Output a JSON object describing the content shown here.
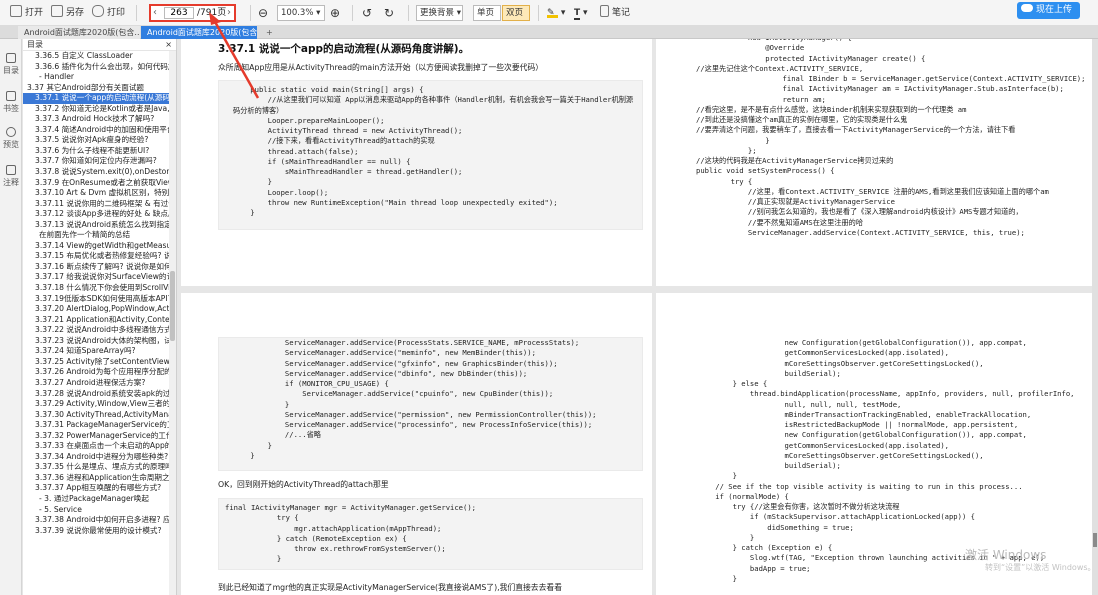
{
  "toolbar": {
    "open": "打开",
    "saveas": "另存",
    "print": "打印",
    "page_current": "263",
    "page_total": "/791页",
    "zoom": "100.3%",
    "background": "更换背景",
    "single": "单页",
    "double": "双页",
    "note": "笔记",
    "upload": "现在上传"
  },
  "tabs": [
    {
      "label": "Android面试题库2020版(包含..."
    },
    {
      "label": "Android面试题库2020版(包含..."
    }
  ],
  "left_strip": [
    "目录",
    "书签",
    "预览",
    "注释"
  ],
  "toc": {
    "title": "目录",
    "items": [
      "3.36.5 自定义 ClassLoader",
      "3.36.6 插件化为什么会出现，如何代码加",
      "- Handler",
      "3.37 其它Android部分有关面试题",
      "3.37.1 说说一个app的启动流程(从源码角度讲解)",
      "3.37.2 你知道无论是Kotlin或者是Java,我们",
      "3.37.3 Android Hock技术了解吗?",
      "3.37.4 简述Android中的加固和使用平台",
      "3.37.5 说说你对Apk瘦身的经验?",
      "3.37.6 为什么子线程不能更新UI?",
      "3.37.7 你知道如何定位内存泄漏吗?",
      "3.37.8 说说System.exit(0),onDestory(),A",
      "3.37.9 在OnResume或者之前获取View的",
      "3.37.10 Art & Dvm 虚拟机区别，特别是",
      "3.37.11 说说你用的二维码框架 & 有过优",
      "3.37.12 谈谈App多进程的好处 & 缺点。",
      "3.37.13 说说Android系统怎么找到指定的",
      "在前面先作一个精简的总结",
      "3.37.14 View的getWidth和getMeasure",
      "3.37.15 布局优化或者热修复经验吗? 说说",
      "3.37.16 断点续传了解吗? 说说你是如何实",
      "3.37.17 给我说说你对SurfaceView的认识",
      "3.37.18 什么情况下你会使用到ScrollView",
      "3.37.19低版本SDK如何使用高版本API?",
      "3.37.20 AlertDialog,PopWindow,Activit",
      "3.37.21 Application和Activity,Context的",
      "3.37.22 说说Android中多线程通信方式?",
      "3.37.23 说说Android大体的架构图，试着",
      "3.37.24 知道SpareArray吗?",
      "3.37.25 Activity除了setContentView可以",
      "3.37.26 Android为每个应用程序分配的内",
      "3.37.27 Android进程保活方案?",
      "3.37.28 说说Android系统安装apk的过程",
      "3.37.29 Activity,Window,View三者的关系",
      "3.37.30 ActivityThread,ActivityManager",
      "3.37.31 PackageManagerService的工作",
      "3.37.32 PowerManagerService的工作方",
      "3.37.33 在桌面点击一个未启动的App的流",
      "3.37.34 Android中进程分为哪些种类?",
      "3.37.35 什么是埋点、埋点方式的原理吗?",
      "3.37.36 进程和Application生命周期之间",
      "3.37.37 App相互唤醒的有哪些方式?",
      "- 3. 通过PackageManager唤起",
      "- 5. Service",
      "3.37.38 Android中如何开启多进程? 应用",
      "3.37.39 说说你最常使用的设计模式?"
    ]
  },
  "page1": {
    "title": "3.37.1 说说一个app的启动流程(从源码角度讲解)。",
    "intro": "众所周知App应用是从ActivityThread的main方法开始（以方便阅读我删掉了一些次要代码）",
    "code": [
      "    public static void main(String[] args) {",
      "        //从这里我们可以知道 App以消息来驱动App的各种事件（Handler机制，有机会我会写一篇关于Handler机制源",
      "码分析的博客）",
      "        Looper.prepareMainLooper();",
      "        ActivityThread thread = new ActivityThread();",
      "        //接下来，看看ActivityThread的attach的实现",
      "        thread.attach(false);",
      "        if (sMainThreadHandler == null) {",
      "            sMainThreadHandler = thread.getHandler();",
      "        }",
      "        Looper.loop();",
      "        throw new RuntimeException(\"Main thread loop unexpectedly exited\");",
      "    }"
    ]
  },
  "page2": {
    "code": [
      "            new IActivityManager() {",
      "                @Override",
      "                protected IActivityManager create() {",
      "//这里先记住这个Context.ACTIVITY_SERVICE,",
      "                    final IBinder b = ServiceManager.getService(Context.ACTIVITY_SERVICE);",
      "                    final IActivityManager am = IActivityManager.Stub.asInterface(b);",
      "                    return am;",
      "//看完这里，是不是有点什么感觉，这块Binder机制来实现获取到的一个代理类 am",
      "//到此还是没搞懂这个am真正的实例在哪里，它的实现类是什么鬼",
      "//要弄清这个问题，我要稍车了，直接去看一下ActivityManagerService的一个方法，请往下看",
      "                }",
      "            };",
      "//这块的代码我是在ActivityManagerService拷贝过来的",
      "public void setSystemProcess() {",
      "        try {",
      "            //这里，看Context.ACTIVITY_SERVICE 注册的AMS,看到这里我们应该知道上面的哪个am",
      "            //真正实现就是ActivityManagerService",
      "            //别问我怎么知道的，我也是看了《深入理解android内核设计》AMS专题才知道的，",
      "            //要不然鬼知道AMS在这里注册的哈",
      "            ServiceManager.addService(Context.ACTIVITY_SERVICE, this, true);"
    ]
  },
  "page3": {
    "code1": [
      "            ServiceManager.addService(ProcessStats.SERVICE_NAME, mProcessStats);",
      "            ServiceManager.addService(\"meminfo\", new MemBinder(this));",
      "            ServiceManager.addService(\"gfxinfo\", new GraphicsBinder(this));",
      "            ServiceManager.addService(\"dbinfo\", new DbBinder(this));",
      "            if (MONITOR_CPU_USAGE) {",
      "                ServiceManager.addService(\"cpuinfo\", new CpuBinder(this));",
      "            }",
      "            ServiceManager.addService(\"permission\", new PermissionController(this));",
      "            ServiceManager.addService(\"processinfo\", new ProcessInfoService(this));",
      "            //...省略",
      "        }",
      "    }"
    ],
    "text1": "OK，回到刚开始的ActivityThread的attach那里",
    "code2": [
      "final IActivityManager mgr = ActivityManager.getService();",
      "            try {",
      "                mgr.attachApplication(mAppThread);",
      "            } catch (RemoteException ex) {",
      "                throw ex.rethrowFromSystemServer();",
      "            }"
    ],
    "text2": "到此已经知道了mgr他的真正实现是ActivityManagerService(我直接说AMS了),我们直接去去看看"
  },
  "page4": {
    "code": [
      "                    new Configuration(getGlobalConfiguration()), app.compat,",
      "                    getCommonServicesLocked(app.isolated),",
      "                    mCoreSettingsObserver.getCoreSettingsLocked(),",
      "                    buildSerial);",
      "        } else {",
      "            thread.bindApplication(processName, appInfo, providers, null, profilerInfo,",
      "                    null, null, null, testMode,",
      "                    mBinderTransactionTrackingEnabled, enableTrackAllocation,",
      "                    isRestrictedBackupMode || !normalMode, app.persistent,",
      "                    new Configuration(getGlobalConfiguration()), app.compat,",
      "                    getCommonServicesLocked(app.isolated),",
      "                    mCoreSettingsObserver.getCoreSettingsLocked(),",
      "                    buildSerial);",
      "        }",
      "    // See if the top visible activity is waiting to run in this process...",
      "    if (normalMode) {",
      "        try {//这里会有你害，这次暂时不做分析这块流程",
      "            if (mStackSupervisor.attachApplicationLocked(app)) {",
      "                didSomething = true;",
      "            }",
      "        } catch (Exception e) {",
      "            Slog.wtf(TAG, \"Exception thrown launching activities in \" + app, e);",
      "            badApp = true;",
      "        }"
    ]
  },
  "watermark": {
    "line1": "激活 Windows",
    "line2": "转到“设置”以激活 Windows。"
  }
}
